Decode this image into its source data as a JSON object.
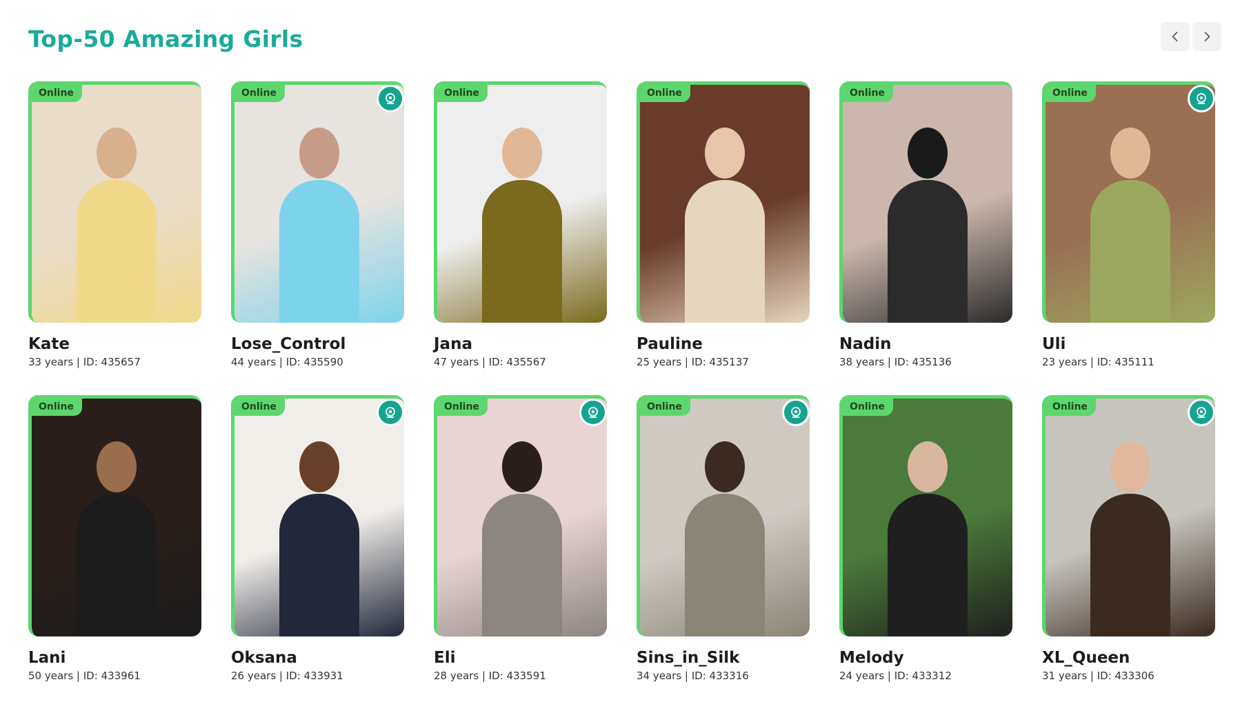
{
  "section": {
    "title": "Top-50 Amazing Girls"
  },
  "nav": {
    "prev_icon": "chevron-left-icon",
    "next_icon": "chevron-right-icon"
  },
  "colors": {
    "accent": "#1aab9a",
    "online": "#5ed66e",
    "camera": "#16a390"
  },
  "profiles": [
    {
      "name": "Kate",
      "meta": "33 years | ID: 435657",
      "status": "Online",
      "video": false,
      "bg": [
        "#e9ddc9",
        "#f0d98a",
        "#d9b08c"
      ]
    },
    {
      "name": "Lose_Control",
      "meta": "44 years | ID: 435590",
      "status": "Online",
      "video": true,
      "bg": [
        "#e7e3df",
        "#7dd3ea",
        "#c79c86"
      ]
    },
    {
      "name": "Jana",
      "meta": "47 years | ID: 435567",
      "status": "Online",
      "video": false,
      "bg": [
        "#eeeeee",
        "#7a6a1d",
        "#e0b898"
      ]
    },
    {
      "name": "Pauline",
      "meta": "25 years | ID: 435137",
      "status": "Online",
      "video": false,
      "bg": [
        "#6a3a2a",
        "#e6d6bf",
        "#e8c4a8"
      ]
    },
    {
      "name": "Nadin",
      "meta": "38 years | ID: 435136",
      "status": "Online",
      "video": false,
      "bg": [
        "#cbb7ad",
        "#2b2b2b",
        "#1a1a1a"
      ]
    },
    {
      "name": "Uli",
      "meta": "23 years | ID: 435111",
      "status": "Online",
      "video": true,
      "bg": [
        "#9a6f52",
        "#9ca85f",
        "#e2b894"
      ]
    },
    {
      "name": "Lani",
      "meta": "50 years | ID: 433961",
      "status": "Online",
      "video": false,
      "bg": [
        "#2a1e1a",
        "#1c1c1c",
        "#9a6e4c"
      ]
    },
    {
      "name": "Oksana",
      "meta": "26 years | ID: 433931",
      "status": "Online",
      "video": true,
      "bg": [
        "#f1eeea",
        "#22283a",
        "#6a3f2a"
      ]
    },
    {
      "name": "Eli",
      "meta": "28 years | ID: 433591",
      "status": "Online",
      "video": true,
      "bg": [
        "#e8d4d4",
        "#8c8580",
        "#2a1e1a"
      ]
    },
    {
      "name": "Sins_in_Silk",
      "meta": "34 years | ID: 433316",
      "status": "Online",
      "video": true,
      "bg": [
        "#cfc9c2",
        "#8a8577",
        "#3a2a22"
      ]
    },
    {
      "name": "Melody",
      "meta": "24 years | ID: 433312",
      "status": "Online",
      "video": false,
      "bg": [
        "#4b7a3a",
        "#1f1f1f",
        "#d9b79e"
      ]
    },
    {
      "name": "XL_Queen",
      "meta": "31 years | ID: 433306",
      "status": "Online",
      "video": true,
      "bg": [
        "#c7c4be",
        "#3a2a20",
        "#e1b89c"
      ]
    }
  ]
}
